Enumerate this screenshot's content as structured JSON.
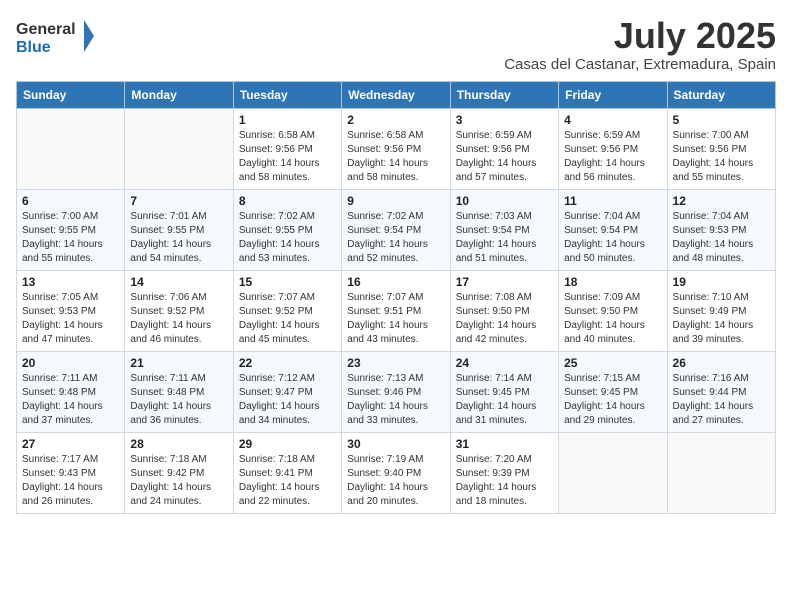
{
  "header": {
    "logo_line1": "General",
    "logo_line2": "Blue",
    "month_year": "July 2025",
    "location": "Casas del Castanar, Extremadura, Spain"
  },
  "weekdays": [
    "Sunday",
    "Monday",
    "Tuesday",
    "Wednesday",
    "Thursday",
    "Friday",
    "Saturday"
  ],
  "weeks": [
    [
      {
        "day": "",
        "sunrise": "",
        "sunset": "",
        "daylight": ""
      },
      {
        "day": "",
        "sunrise": "",
        "sunset": "",
        "daylight": ""
      },
      {
        "day": "1",
        "sunrise": "Sunrise: 6:58 AM",
        "sunset": "Sunset: 9:56 PM",
        "daylight": "Daylight: 14 hours and 58 minutes."
      },
      {
        "day": "2",
        "sunrise": "Sunrise: 6:58 AM",
        "sunset": "Sunset: 9:56 PM",
        "daylight": "Daylight: 14 hours and 58 minutes."
      },
      {
        "day": "3",
        "sunrise": "Sunrise: 6:59 AM",
        "sunset": "Sunset: 9:56 PM",
        "daylight": "Daylight: 14 hours and 57 minutes."
      },
      {
        "day": "4",
        "sunrise": "Sunrise: 6:59 AM",
        "sunset": "Sunset: 9:56 PM",
        "daylight": "Daylight: 14 hours and 56 minutes."
      },
      {
        "day": "5",
        "sunrise": "Sunrise: 7:00 AM",
        "sunset": "Sunset: 9:56 PM",
        "daylight": "Daylight: 14 hours and 55 minutes."
      }
    ],
    [
      {
        "day": "6",
        "sunrise": "Sunrise: 7:00 AM",
        "sunset": "Sunset: 9:55 PM",
        "daylight": "Daylight: 14 hours and 55 minutes."
      },
      {
        "day": "7",
        "sunrise": "Sunrise: 7:01 AM",
        "sunset": "Sunset: 9:55 PM",
        "daylight": "Daylight: 14 hours and 54 minutes."
      },
      {
        "day": "8",
        "sunrise": "Sunrise: 7:02 AM",
        "sunset": "Sunset: 9:55 PM",
        "daylight": "Daylight: 14 hours and 53 minutes."
      },
      {
        "day": "9",
        "sunrise": "Sunrise: 7:02 AM",
        "sunset": "Sunset: 9:54 PM",
        "daylight": "Daylight: 14 hours and 52 minutes."
      },
      {
        "day": "10",
        "sunrise": "Sunrise: 7:03 AM",
        "sunset": "Sunset: 9:54 PM",
        "daylight": "Daylight: 14 hours and 51 minutes."
      },
      {
        "day": "11",
        "sunrise": "Sunrise: 7:04 AM",
        "sunset": "Sunset: 9:54 PM",
        "daylight": "Daylight: 14 hours and 50 minutes."
      },
      {
        "day": "12",
        "sunrise": "Sunrise: 7:04 AM",
        "sunset": "Sunset: 9:53 PM",
        "daylight": "Daylight: 14 hours and 48 minutes."
      }
    ],
    [
      {
        "day": "13",
        "sunrise": "Sunrise: 7:05 AM",
        "sunset": "Sunset: 9:53 PM",
        "daylight": "Daylight: 14 hours and 47 minutes."
      },
      {
        "day": "14",
        "sunrise": "Sunrise: 7:06 AM",
        "sunset": "Sunset: 9:52 PM",
        "daylight": "Daylight: 14 hours and 46 minutes."
      },
      {
        "day": "15",
        "sunrise": "Sunrise: 7:07 AM",
        "sunset": "Sunset: 9:52 PM",
        "daylight": "Daylight: 14 hours and 45 minutes."
      },
      {
        "day": "16",
        "sunrise": "Sunrise: 7:07 AM",
        "sunset": "Sunset: 9:51 PM",
        "daylight": "Daylight: 14 hours and 43 minutes."
      },
      {
        "day": "17",
        "sunrise": "Sunrise: 7:08 AM",
        "sunset": "Sunset: 9:50 PM",
        "daylight": "Daylight: 14 hours and 42 minutes."
      },
      {
        "day": "18",
        "sunrise": "Sunrise: 7:09 AM",
        "sunset": "Sunset: 9:50 PM",
        "daylight": "Daylight: 14 hours and 40 minutes."
      },
      {
        "day": "19",
        "sunrise": "Sunrise: 7:10 AM",
        "sunset": "Sunset: 9:49 PM",
        "daylight": "Daylight: 14 hours and 39 minutes."
      }
    ],
    [
      {
        "day": "20",
        "sunrise": "Sunrise: 7:11 AM",
        "sunset": "Sunset: 9:48 PM",
        "daylight": "Daylight: 14 hours and 37 minutes."
      },
      {
        "day": "21",
        "sunrise": "Sunrise: 7:11 AM",
        "sunset": "Sunset: 9:48 PM",
        "daylight": "Daylight: 14 hours and 36 minutes."
      },
      {
        "day": "22",
        "sunrise": "Sunrise: 7:12 AM",
        "sunset": "Sunset: 9:47 PM",
        "daylight": "Daylight: 14 hours and 34 minutes."
      },
      {
        "day": "23",
        "sunrise": "Sunrise: 7:13 AM",
        "sunset": "Sunset: 9:46 PM",
        "daylight": "Daylight: 14 hours and 33 minutes."
      },
      {
        "day": "24",
        "sunrise": "Sunrise: 7:14 AM",
        "sunset": "Sunset: 9:45 PM",
        "daylight": "Daylight: 14 hours and 31 minutes."
      },
      {
        "day": "25",
        "sunrise": "Sunrise: 7:15 AM",
        "sunset": "Sunset: 9:45 PM",
        "daylight": "Daylight: 14 hours and 29 minutes."
      },
      {
        "day": "26",
        "sunrise": "Sunrise: 7:16 AM",
        "sunset": "Sunset: 9:44 PM",
        "daylight": "Daylight: 14 hours and 27 minutes."
      }
    ],
    [
      {
        "day": "27",
        "sunrise": "Sunrise: 7:17 AM",
        "sunset": "Sunset: 9:43 PM",
        "daylight": "Daylight: 14 hours and 26 minutes."
      },
      {
        "day": "28",
        "sunrise": "Sunrise: 7:18 AM",
        "sunset": "Sunset: 9:42 PM",
        "daylight": "Daylight: 14 hours and 24 minutes."
      },
      {
        "day": "29",
        "sunrise": "Sunrise: 7:18 AM",
        "sunset": "Sunset: 9:41 PM",
        "daylight": "Daylight: 14 hours and 22 minutes."
      },
      {
        "day": "30",
        "sunrise": "Sunrise: 7:19 AM",
        "sunset": "Sunset: 9:40 PM",
        "daylight": "Daylight: 14 hours and 20 minutes."
      },
      {
        "day": "31",
        "sunrise": "Sunrise: 7:20 AM",
        "sunset": "Sunset: 9:39 PM",
        "daylight": "Daylight: 14 hours and 18 minutes."
      },
      {
        "day": "",
        "sunrise": "",
        "sunset": "",
        "daylight": ""
      },
      {
        "day": "",
        "sunrise": "",
        "sunset": "",
        "daylight": ""
      }
    ]
  ]
}
